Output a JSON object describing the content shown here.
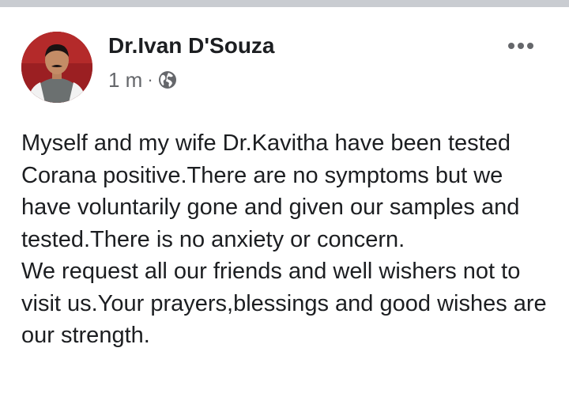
{
  "post": {
    "author": {
      "name": "Dr.Ivan D'Souza",
      "avatar_icon": "profile-photo"
    },
    "timestamp": "1 m",
    "separator": "·",
    "privacy_icon": "globe-icon",
    "more_icon": "more-options-icon",
    "paragraphs": [
      "Myself and my wife Dr.Kavitha have been tested Corana positive.There are no symptoms but we have voluntarily gone and given our samples and tested.There is no anxiety or concern.",
      "We request all our friends and well wishers not to visit us.Your prayers,blessings and good wishes are our strength."
    ]
  },
  "colors": {
    "top_bar": "#c9ccd1",
    "secondary_text": "#65676b",
    "primary_text": "#1c1e21"
  }
}
